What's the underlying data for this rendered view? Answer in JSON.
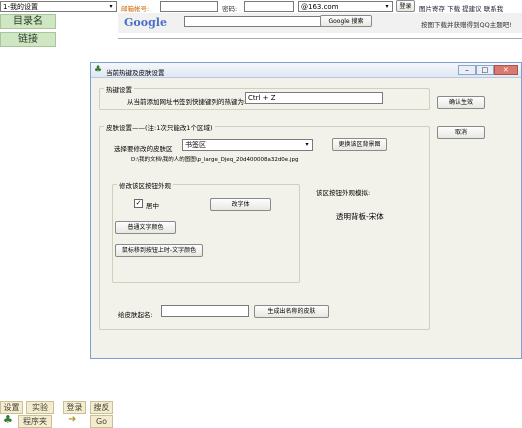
{
  "topbar": {
    "left_select": "1-我的设置",
    "account_label": "邮箱帐号:",
    "password_label": "密码:",
    "domain_select": "@163.com",
    "login_button": "登录",
    "links": "图片寄存 下载  提建议  联系我",
    "google_logo": "Google",
    "google_search_button": "Google 搜索",
    "ad_text": "按图下载并获赠得到QQ主题吧!"
  },
  "sidebar": {
    "catalog_button": "目录名",
    "link_button": "链接"
  },
  "dialog": {
    "title": "当前热键及皮肤设置",
    "hotkey_group": "热键设置",
    "hotkey_prompt": "从当前添加网址书签到快捷键列的热键为:",
    "hotkey_value": "Ctrl + Z",
    "apply_button": "确认生效",
    "cancel_button": "取消",
    "skin_group": "皮肤设置——(注:1次只能改1个区域)",
    "skin_region_label": "选择要修改的皮肤区",
    "skin_region_value": "书签区",
    "change_bg_button": "更换该区背景图",
    "bg_path": "D:\\我的文档\\我的人的图图\\p_large_Djeq_20d400008a32d0e.jpg",
    "button_style_group": "修改该区按钮外观",
    "center_checkbox": "居中",
    "font_button": "改字体",
    "text_color_button": "普通文字颜色",
    "hover_color_button": "鼠标移到按钮上时-文字颜色",
    "preview_label": "该区按钮外观模拟:",
    "preview_text": "透明背板-宋体",
    "skin_name_label": "给皮肤起名:",
    "skin_name_value": "",
    "generate_button": "生成出名称的皮肤"
  },
  "bottom": {
    "settings": "设置",
    "lab": "实验",
    "login": "登录",
    "search": "搜反",
    "program": "程序夹",
    "go": "Go"
  }
}
